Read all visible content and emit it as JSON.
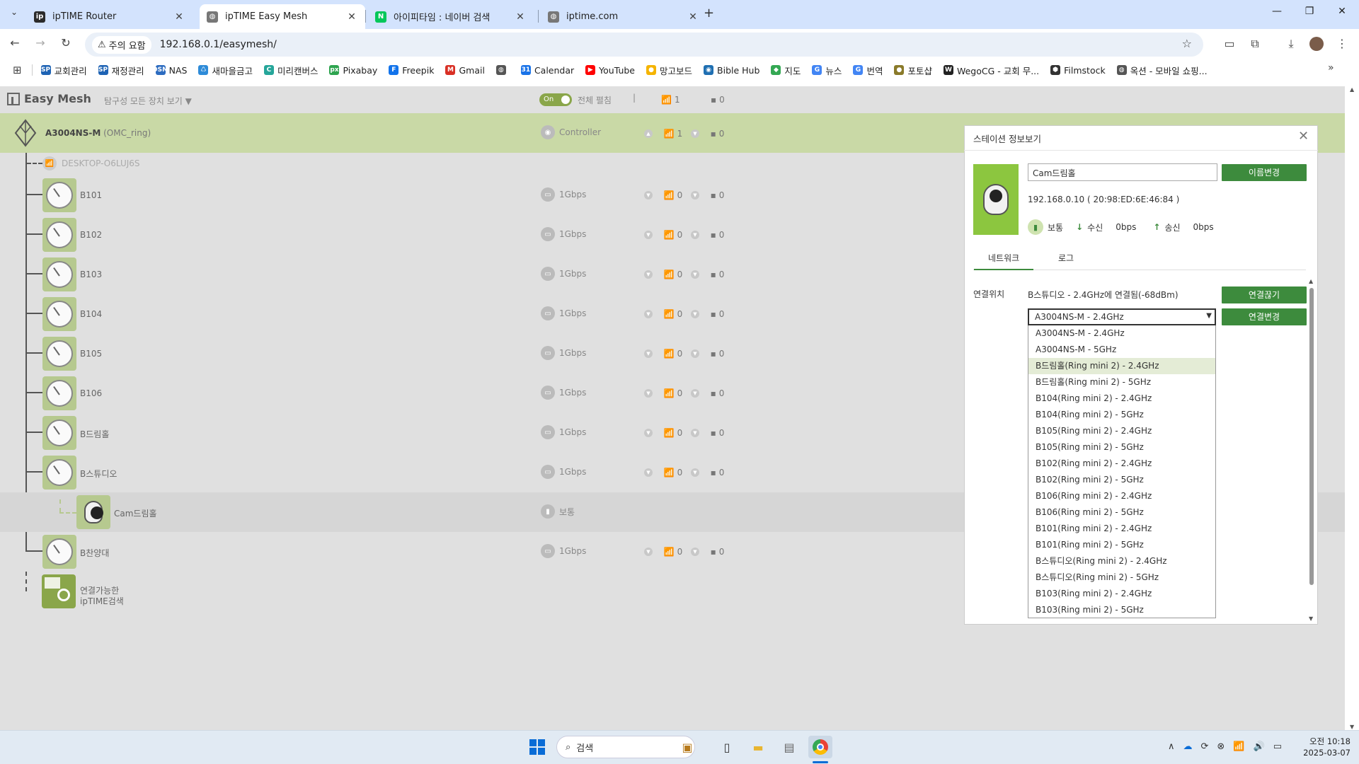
{
  "browser": {
    "tabs": [
      {
        "title": "ipTIME Router",
        "fav": "ip",
        "fav_color": "#2b2b2b"
      },
      {
        "title": "ipTIME Easy Mesh",
        "fav": "◍",
        "fav_color": "#777777"
      },
      {
        "title": "아이피타임 : 네이버 검색",
        "fav": "N",
        "fav_color": "#03c75a"
      },
      {
        "title": "iptime.com",
        "fav": "◍",
        "fav_color": "#777777"
      }
    ],
    "warning": "주의 요함",
    "url": "192.168.0.1/easymesh/",
    "bookmarks": [
      {
        "label": "교회관리",
        "icon": "SP",
        "color": "#1e63b4"
      },
      {
        "label": "재정관리",
        "icon": "SP",
        "color": "#1e63b4"
      },
      {
        "label": "NAS",
        "icon": "DSM",
        "color": "#2d6cc0"
      },
      {
        "label": "새마을금고",
        "icon": "♺",
        "color": "#2e8bd8"
      },
      {
        "label": "미리캔버스",
        "icon": "C",
        "color": "#26a69a"
      },
      {
        "label": "Pixabay",
        "icon": "px",
        "color": "#2ea44f"
      },
      {
        "label": "Freepik",
        "icon": "F",
        "color": "#1273eb"
      },
      {
        "label": "Gmail",
        "icon": "M",
        "color": "#d93025"
      },
      {
        "label": "",
        "icon": "◍",
        "color": "#555555"
      },
      {
        "label": "Calendar",
        "icon": "31",
        "color": "#1a73e8"
      },
      {
        "label": "YouTube",
        "icon": "▶",
        "color": "#ff0000"
      },
      {
        "label": "망고보드",
        "icon": "●",
        "color": "#f5b400"
      },
      {
        "label": "Bible Hub",
        "icon": "◉",
        "color": "#1f6fb2"
      },
      {
        "label": "지도",
        "icon": "◆",
        "color": "#34a853"
      },
      {
        "label": "뉴스",
        "icon": "G",
        "color": "#4285f4"
      },
      {
        "label": "번역",
        "icon": "G",
        "color": "#4285f4"
      },
      {
        "label": "포토샵",
        "icon": "●",
        "color": "#8a7a2a"
      },
      {
        "label": "WegoCG - 교회 무...",
        "icon": "W",
        "color": "#222222"
      },
      {
        "label": "Filmstock",
        "icon": "⬢",
        "color": "#333333"
      },
      {
        "label": "옥션 - 모바일 쇼핑...",
        "icon": "◍",
        "color": "#555555"
      }
    ]
  },
  "header": {
    "title": "Easy Mesh",
    "filter": "탐구성 모든 장치 보기 ▼",
    "toggle": "On",
    "toggle_label": "전체 펼침",
    "wifi": "1",
    "wired": "0"
  },
  "controller": {
    "name": "A3004NS-M",
    "alias": "(OMC_ring)",
    "role": "Controller",
    "wifi": "1",
    "wired": "0"
  },
  "desktop": "DESKTOP-O6LUJ6S",
  "nodes": [
    {
      "name": "B101",
      "speed": "1Gbps",
      "wifi": "0",
      "wired": "0"
    },
    {
      "name": "B102",
      "speed": "1Gbps",
      "wifi": "0",
      "wired": "0"
    },
    {
      "name": "B103",
      "speed": "1Gbps",
      "wifi": "0",
      "wired": "0"
    },
    {
      "name": "B104",
      "speed": "1Gbps",
      "wifi": "0",
      "wired": "0"
    },
    {
      "name": "B105",
      "speed": "1Gbps",
      "wifi": "0",
      "wired": "0"
    },
    {
      "name": "B106",
      "speed": "1Gbps",
      "wifi": "0",
      "wired": "0"
    },
    {
      "name": "B드림홀",
      "speed": "1Gbps",
      "wifi": "0",
      "wired": "0"
    },
    {
      "name": "B스튜디오",
      "speed": "1Gbps",
      "wifi": "0",
      "wired": "0"
    }
  ],
  "camera_row": {
    "name": "Cam드림홀",
    "signal": "보통"
  },
  "last_node": {
    "name": "B찬양대",
    "speed": "1Gbps",
    "wifi": "0",
    "wired": "0"
  },
  "search_node": {
    "line1": "연결가능한",
    "line2": "ipTIME검색"
  },
  "panel": {
    "title": "스테이션 정보보기",
    "name_value": "Cam드림홀",
    "rename_button": "이름변경",
    "ip_mac": "192.168.0.10 ( 20:98:ED:6E:46:84 )",
    "signal": "보통",
    "rx_label": "수신",
    "rx_value": "0bps",
    "tx_label": "송신",
    "tx_value": "0bps",
    "tab_network": "네트워크",
    "tab_log": "로그",
    "conn_label": "연결위치",
    "conn_text": "B스튜디오 - 2.4GHz에 연결됨(-68dBm)",
    "disconnect_button": "연결끊기",
    "change_button": "연결변경",
    "selected": "A3004NS-M - 2.4GHz",
    "options": [
      "A3004NS-M - 2.4GHz",
      "A3004NS-M - 5GHz",
      "B드림홀(Ring mini 2) - 2.4GHz",
      "B드림홀(Ring mini 2) - 5GHz",
      "B104(Ring mini 2) - 2.4GHz",
      "B104(Ring mini 2) - 5GHz",
      "B105(Ring mini 2) - 2.4GHz",
      "B105(Ring mini 2) - 5GHz",
      "B102(Ring mini 2) - 2.4GHz",
      "B102(Ring mini 2) - 5GHz",
      "B106(Ring mini 2) - 2.4GHz",
      "B106(Ring mini 2) - 5GHz",
      "B101(Ring mini 2) - 2.4GHz",
      "B101(Ring mini 2) - 5GHz",
      "B스튜디오(Ring mini 2) - 2.4GHz",
      "B스튜디오(Ring mini 2) - 5GHz",
      "B103(Ring mini 2) - 2.4GHz",
      "B103(Ring mini 2) - 5GHz"
    ],
    "highlighted_index": 2
  },
  "taskbar": {
    "search": "검색",
    "time": "오전 10:18",
    "date": "2025-03-07"
  }
}
